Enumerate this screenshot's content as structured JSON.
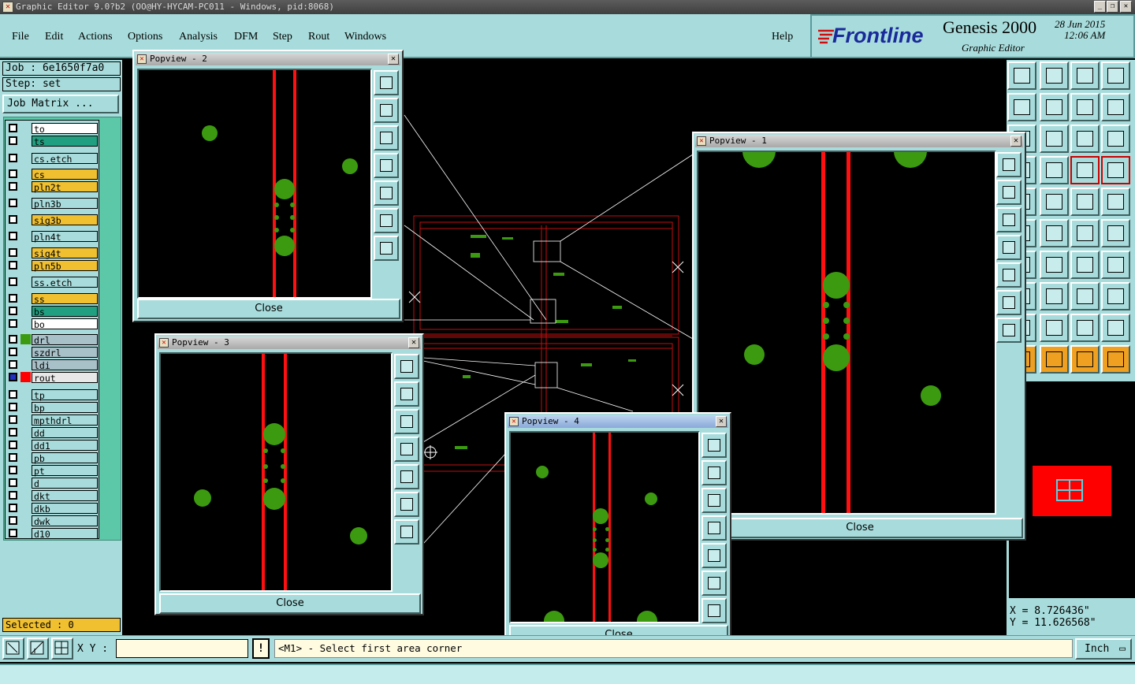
{
  "window": {
    "title": "Graphic Editor 9.0?b2 (OO@HY-HYCAM-PC011 - Windows, pid:8068)"
  },
  "menu": {
    "items": [
      "File",
      "Edit",
      "Actions",
      "Options",
      "Analysis",
      "DFM",
      "Step",
      "Rout",
      "Windows"
    ],
    "help": "Help"
  },
  "brand": {
    "logo": "Frontline",
    "product": "Genesis 2000",
    "subtitle": "Graphic Editor",
    "date": "28 Jun 2015",
    "time": "12:06 AM"
  },
  "job": {
    "job_label": "Job : 6e1650f7a0",
    "step_label": "Step: set",
    "matrix_button": "Job Matrix ..."
  },
  "layers": [
    {
      "name": "to",
      "color": "#ffffff"
    },
    {
      "name": "ts",
      "color": "#20a080"
    },
    {
      "name": "cs.etch",
      "color": "#a8dcdc"
    },
    {
      "name": "cs",
      "color": "#f0c030"
    },
    {
      "name": "pln2t",
      "color": "#f0c030"
    },
    {
      "name": "pln3b",
      "color": "#a8dcdc"
    },
    {
      "name": "sig3b",
      "color": "#f0c030"
    },
    {
      "name": "pln4t",
      "color": "#a8dcdc"
    },
    {
      "name": "sig4t",
      "color": "#f0c030"
    },
    {
      "name": "pln5b",
      "color": "#f0c030"
    },
    {
      "name": "ss.etch",
      "color": "#a8dcdc"
    },
    {
      "name": "ss",
      "color": "#f0c030"
    },
    {
      "name": "bs",
      "color": "#20a080"
    },
    {
      "name": "bo",
      "color": "#ffffff"
    },
    {
      "name": "drl",
      "color": "#a8c0c8"
    },
    {
      "name": "szdrl",
      "color": "#a8c0c8"
    },
    {
      "name": "ldi",
      "color": "#a8c0c8"
    },
    {
      "name": "rout",
      "color": "#e8e8e8"
    },
    {
      "name": "tp",
      "color": "#a8dcdc"
    },
    {
      "name": "bp",
      "color": "#a8dcdc"
    },
    {
      "name": "mpthdrl",
      "color": "#a8dcdc"
    },
    {
      "name": "dd",
      "color": "#a8dcdc"
    },
    {
      "name": "dd1",
      "color": "#a8dcdc"
    },
    {
      "name": "pb",
      "color": "#a8dcdc"
    },
    {
      "name": "pt",
      "color": "#a8dcdc"
    },
    {
      "name": "d",
      "color": "#a8dcdc"
    },
    {
      "name": "dkt",
      "color": "#a8dcdc"
    },
    {
      "name": "dkb",
      "color": "#a8dcdc"
    },
    {
      "name": "dwk",
      "color": "#a8dcdc"
    },
    {
      "name": "d10",
      "color": "#a8dcdc"
    }
  ],
  "selected": "Selected : 0",
  "popviews": [
    {
      "title": "Popview - 2",
      "close": "Close"
    },
    {
      "title": "Popview - 3",
      "close": "Close"
    },
    {
      "title": "Popview - 1",
      "close": "Close"
    },
    {
      "title": "Popview - 4",
      "close": "Close"
    }
  ],
  "coords": {
    "x": "X = 8.726436\"",
    "y": "Y = 11.626568\""
  },
  "bottom": {
    "xy_label": "X Y :",
    "xy_value": "",
    "excl": "!",
    "prompt": "<M1> - Select first area corner",
    "units": "Inch"
  },
  "colors": {
    "panel": "#a8dcdc",
    "pad": "#3c9a10",
    "trace": "#ff1010"
  }
}
